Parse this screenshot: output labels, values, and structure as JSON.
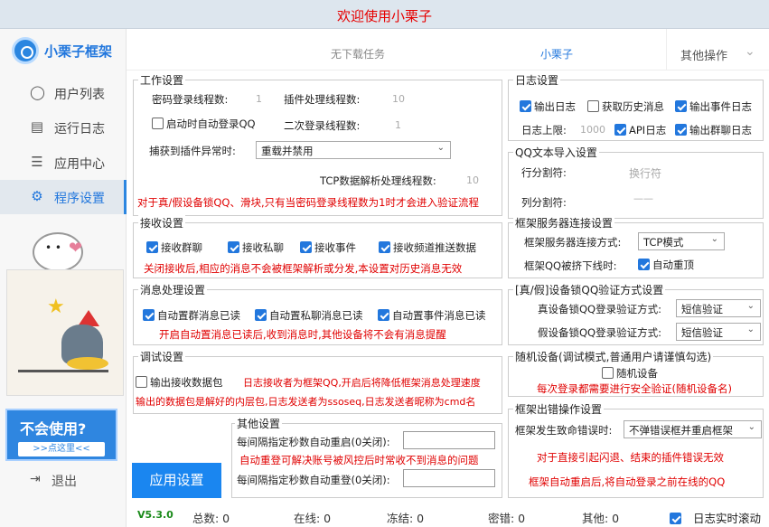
{
  "title": "欢迎使用小栗子",
  "brand": "小栗子框架",
  "nav": [
    {
      "label": "用户列表",
      "icon": "user-icon"
    },
    {
      "label": "运行日志",
      "icon": "log-icon"
    },
    {
      "label": "应用中心",
      "icon": "list-icon"
    },
    {
      "label": "程序设置",
      "icon": "gear-icon"
    }
  ],
  "help": {
    "question": "不会使用?",
    "button": ">>点这里<<"
  },
  "quit": "退出",
  "tabs": {
    "downloads": "无下载任务",
    "account": "小栗子",
    "other": "其他操作"
  },
  "work": {
    "title": "工作设置",
    "pwd_threads_label": "密码登录线程数:",
    "pwd_threads": "1",
    "plugin_threads_label": "插件处理线程数:",
    "plugin_threads": "10",
    "autologin": "启动时自动登录QQ",
    "second_threads_label": "二次登录线程数:",
    "second_threads": "1",
    "exception_label": "捕获到插件异常时:",
    "exception_value": "重载并禁用",
    "tcp_threads_label": "TCP数据解析处理线程数:",
    "tcp_threads": "10",
    "warning": "对于真/假设备锁QQ、滑块,只有当密码登录线程数为1时才会进入验证流程"
  },
  "log": {
    "title": "日志设置",
    "output_log": "输出日志",
    "history_log": "获取历史消息",
    "event_log": "输出事件日志",
    "limit_label": "日志上限:",
    "limit_value": "1000",
    "api_log": "API日志",
    "group_log": "输出群聊日志"
  },
  "qq_import": {
    "title": "QQ文本导入设置",
    "row_label": "行分割符:",
    "row_value": "换行符",
    "col_label": "列分割符:",
    "col_value": "——"
  },
  "receive": {
    "title": "接收设置",
    "group": "接收群聊",
    "private": "接收私聊",
    "event": "接收事件",
    "channel": "接收频道推送数据",
    "note": "关闭接收后,相应的消息不会被框架解析或分发,本设置对历史消息无效"
  },
  "server": {
    "title": "框架服务器连接设置",
    "method_label": "框架服务器连接方式:",
    "method_value": "TCP模式",
    "offline_label": "框架QQ被挤下线时:",
    "reconnect": "自动重顶"
  },
  "msg": {
    "title": "消息处理设置",
    "group_read": "自动置群消息已读",
    "private_read": "自动置私聊消息已读",
    "event_read": "自动置事件消息已读",
    "note": "开启自动置消息已读后,收到消息时,其他设备将不会有消息提醒"
  },
  "devlock": {
    "title": "[真/假]设备锁QQ验证方式设置",
    "real_label": "真设备锁QQ登录验证方式:",
    "real_value": "短信验证",
    "fake_label": "假设备锁QQ登录验证方式:",
    "fake_value": "短信验证"
  },
  "debug": {
    "title": "调试设置",
    "output_packet": "输出接收数据包",
    "note1": "日志接收者为框架QQ,开启后将降低框架消息处理速度",
    "note2": "输出的数据包是解好的内层包,日志发送者为ssoseq,日志发送者昵称为cmd名"
  },
  "random": {
    "title": "随机设备(调试模式,普通用户请谨慎勾选)",
    "checkbox": "随机设备",
    "note": "每次登录都需要进行安全验证(随机设备名)"
  },
  "other": {
    "title": "其他设置",
    "restart_label": "每间隔指定秒数自动重启(0关闭):",
    "note": "自动重登可解决账号被风控后时常收不到消息的问题",
    "relogin_label": "每间隔指定秒数自动重登(0关闭):"
  },
  "crash": {
    "title": "框架出错操作设置",
    "label": "框架发生致命错误时:",
    "value": "不弹错误框并重启框架",
    "note1": "对于直接引起闪退、结束的插件错误无效",
    "note2": "框架自动重启后,将自动登录之前在线的QQ"
  },
  "apply": "应用设置",
  "status": {
    "version": "V5.3.0",
    "total": "总数: 0",
    "online": "在线: 0",
    "frozen": "冻结: 0",
    "pwd_err": "密错: 0",
    "other": "其他: 0",
    "scroll": "日志实时滚动"
  }
}
